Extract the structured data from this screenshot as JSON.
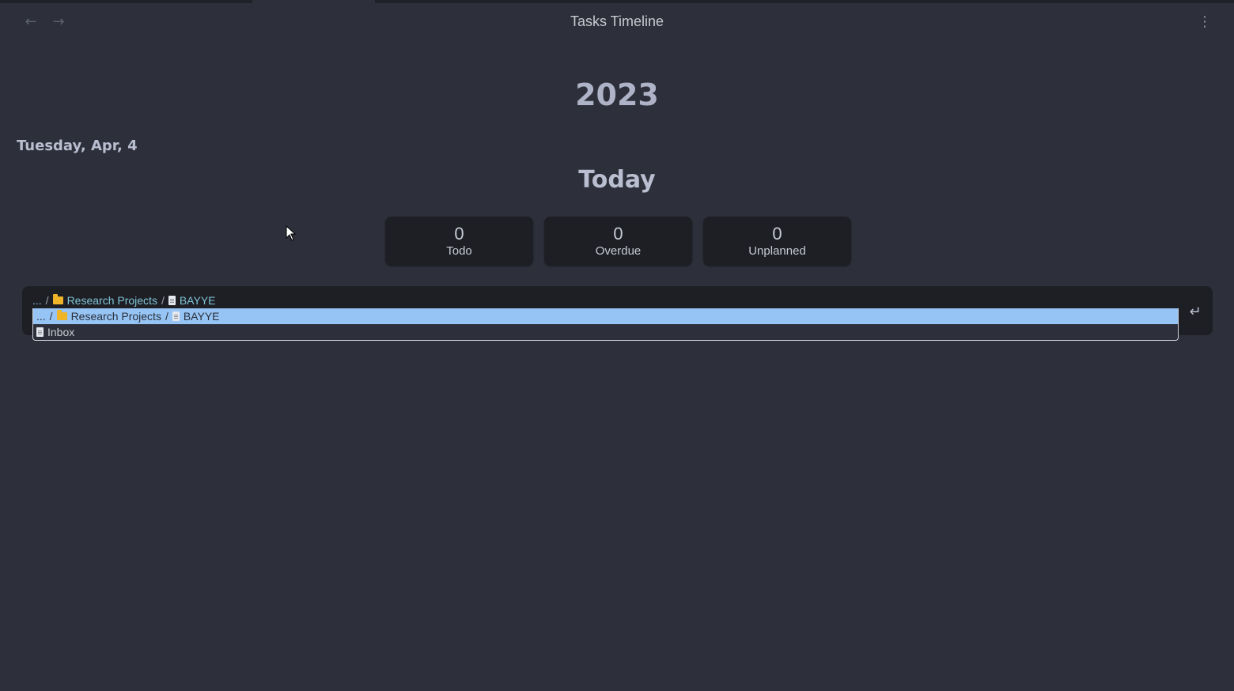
{
  "window": {
    "title": "Tasks Timeline",
    "back_icon": "←",
    "forward_icon": "→",
    "more_icon": "⋮"
  },
  "timeline": {
    "year": "2023",
    "date": "Tuesday, Apr, 4",
    "section": "Today"
  },
  "counters": [
    {
      "value": "0",
      "label": "Todo"
    },
    {
      "value": "0",
      "label": "Overdue"
    },
    {
      "value": "0",
      "label": "Unplanned"
    }
  ],
  "input": {
    "path": {
      "ellipsis": "...",
      "sep": "/",
      "folder": "Research Projects",
      "file": "BAYYE"
    },
    "enter_icon": "↵"
  },
  "dropdown": {
    "items": [
      {
        "ellipsis": "...",
        "sep": "/",
        "folder": "Research Projects",
        "file": "BAYYE"
      },
      {
        "file": "Inbox"
      }
    ]
  }
}
